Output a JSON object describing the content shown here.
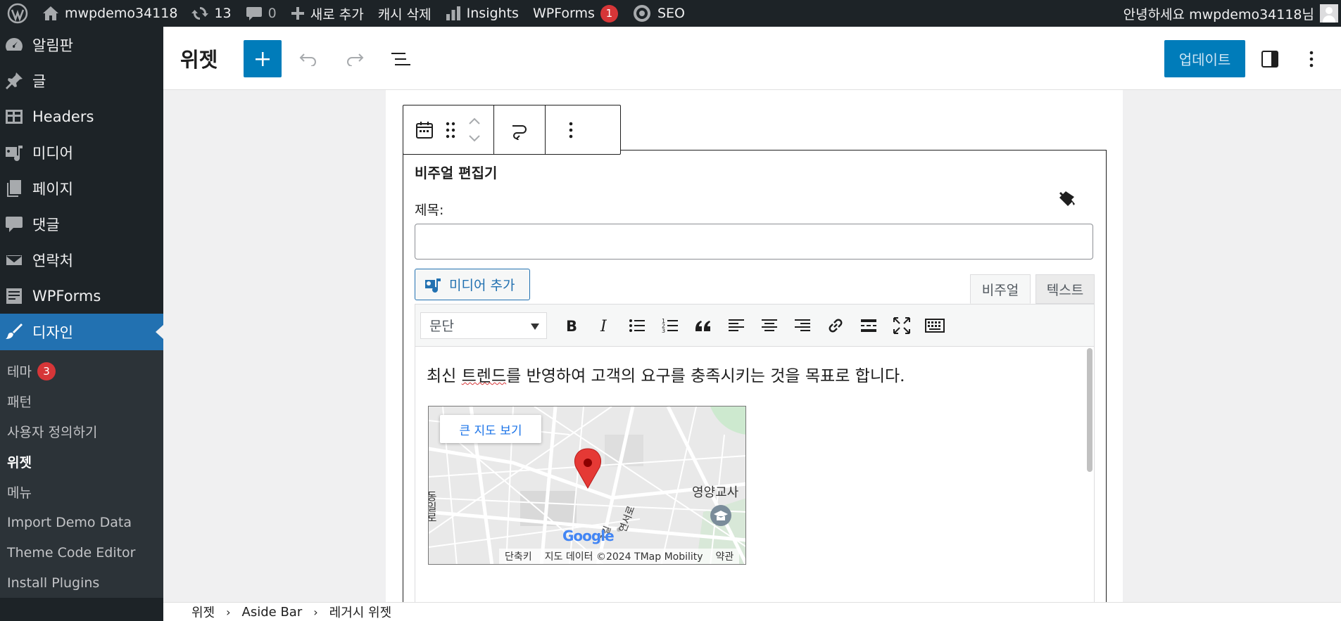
{
  "adminbar": {
    "site_name": "mwpdemo34118",
    "updates_count": "13",
    "comments_count": "0",
    "new_label": "새로 추가",
    "cache_label": "캐시 삭제",
    "insights_label": "Insights",
    "wpforms_label": "WPForms",
    "wpforms_badge": "1",
    "seo_label": "SEO",
    "greeting": "안녕하세요 mwpdemo34118님"
  },
  "sidebar": {
    "items": [
      {
        "label": "알림판",
        "icon": "dashboard-icon"
      },
      {
        "label": "글",
        "icon": "pin-icon"
      },
      {
        "label": "Headers",
        "icon": "table-icon"
      },
      {
        "label": "미디어",
        "icon": "media-icon"
      },
      {
        "label": "페이지",
        "icon": "pages-icon"
      },
      {
        "label": "댓글",
        "icon": "comment-icon"
      },
      {
        "label": "연락처",
        "icon": "mail-icon"
      },
      {
        "label": "WPForms",
        "icon": "forms-icon"
      },
      {
        "label": "디자인",
        "icon": "brush-icon"
      }
    ],
    "submenu": {
      "theme": "테마",
      "theme_badge": "3",
      "patterns": "패턴",
      "customize": "사용자 정의하기",
      "widgets": "위젯",
      "menus": "메뉴",
      "import_demo": "Import Demo Data",
      "theme_code": "Theme Code Editor",
      "install_plugins": "Install Plugins"
    }
  },
  "header": {
    "title": "위젯",
    "update_label": "업데이트"
  },
  "widget": {
    "title": "비주얼 편집기",
    "field_label": "제목:",
    "title_value": "",
    "add_media_label": "미디어 추가",
    "tab_visual": "비주얼",
    "tab_text": "텍스트",
    "format_value": "문단",
    "content_line_a": "최신 ",
    "content_misspelled": "트렌드",
    "content_line_b": "를 반영하여 고객의 요구를 충족시키는 것을 목표로 합니다."
  },
  "map": {
    "large_map_label": "큰 지도 보기",
    "place_label": "영양교사",
    "road_label_a": "동일로",
    "road_label_b": "연서로",
    "road_label_c": "1길",
    "logo": "Google",
    "shortcuts": "단축키",
    "map_data": "지도 데이터 ©2024 TMap Mobility",
    "terms": "약관"
  },
  "breadcrumb": {
    "items": [
      "위젯",
      "Aside Bar",
      "레거시 위젯"
    ]
  },
  "colors": {
    "accent": "#007cba",
    "admin_bg": "#1d2327",
    "active_menu": "#2271b1",
    "badge": "#d63638"
  }
}
